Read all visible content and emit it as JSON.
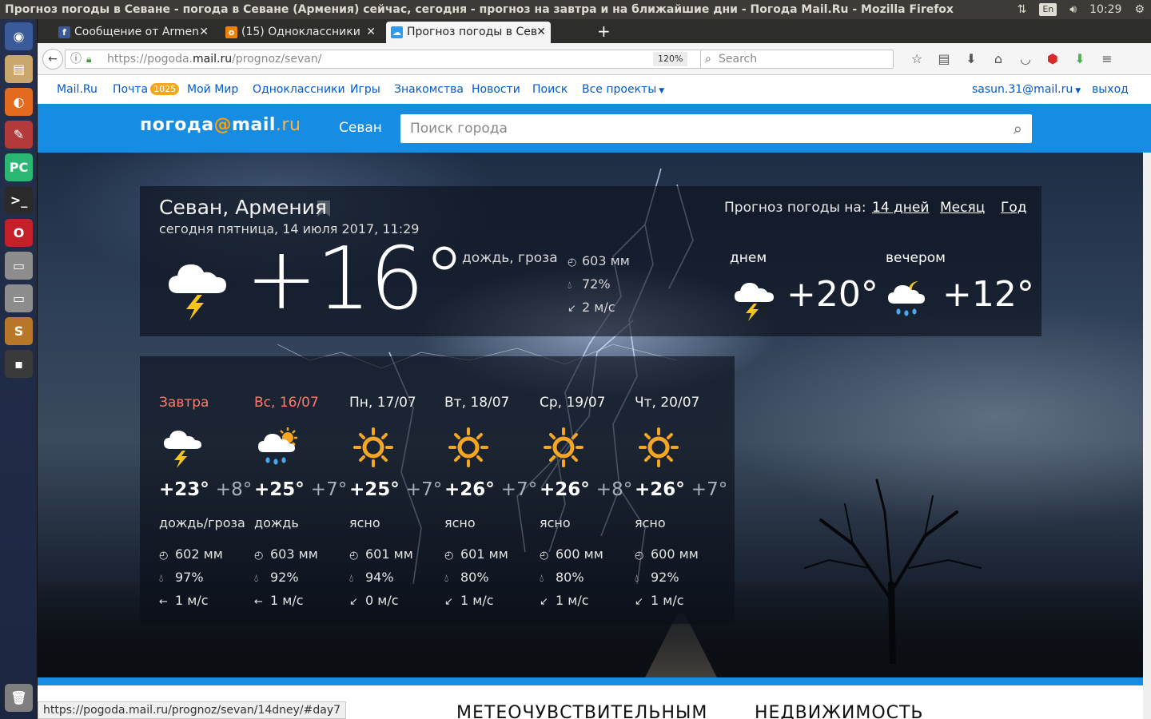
{
  "os": {
    "window_title": "Прогноз погоды в Севане - погода в Севане (Армения) сейчас, сегодня - прогноз на завтра и на ближайшие дни - Погода Mail.Ru - Mozilla Firefox",
    "lang": "En",
    "time": "10:29"
  },
  "tabs": [
    {
      "label": "Сообщение от Armen",
      "icon": "facebook-icon"
    },
    {
      "label": "(15) Одноклассники",
      "icon": "odnoklassniki-icon"
    },
    {
      "label": "Прогноз погоды в Сев",
      "icon": "weather-icon"
    }
  ],
  "nav": {
    "url_prefix": "https://pogoda.",
    "url_domain": "mail.ru",
    "url_path": "/prognoz/sevan/",
    "zoom": "120%",
    "search_placeholder": "Search"
  },
  "portal": {
    "mailru": "Mail.Ru",
    "pochta": "Почта",
    "pochta_count": "1025",
    "moi_mir": "Мой Мир",
    "ok": "Одноклассники",
    "games": "Игры",
    "dating": "Знакомства",
    "news": "Новости",
    "search": "Поиск",
    "all_projects": "Все проекты",
    "user": "sasun.31@mail.ru",
    "logout": "выход"
  },
  "brand": {
    "logo_a": "погода",
    "logo_at": "@",
    "logo_b": "mail",
    "logo_c": ".ru",
    "city_link": "Севан",
    "search_placeholder": "Поиск города"
  },
  "now": {
    "city": "Севан, Армения",
    "date": "сегодня пятница, 14 июля 2017, 11:29",
    "forecast_label": "Прогноз погоды на:",
    "links": [
      "14 дней",
      "Месяц",
      "Год"
    ],
    "temp": "+16°",
    "condition": "дождь, гроза",
    "pressure": "603 мм",
    "humidity": "72%",
    "wind": "2 м/с",
    "day_label": "днем",
    "day_temp": "+20°",
    "evening_label": "вечером",
    "evening_temp": "+12°"
  },
  "days": [
    {
      "name": "Завтра",
      "hi": "+23°",
      "lo": "+8°",
      "cond": "дождь/гроза",
      "pressure": "602 мм",
      "humidity": "97%",
      "wind_dir": "←",
      "wind": "1 м/с",
      "icon": "thunder-cloud-icon",
      "weekend": true
    },
    {
      "name": "Вс, 16/07",
      "hi": "+25°",
      "lo": "+7°",
      "cond": "дождь",
      "pressure": "603 мм",
      "humidity": "92%",
      "wind_dir": "←",
      "wind": "1 м/с",
      "icon": "sun-cloud-rain-icon",
      "weekend": true
    },
    {
      "name": "Пн, 17/07",
      "hi": "+25°",
      "lo": "+7°",
      "cond": "ясно",
      "pressure": "601 мм",
      "humidity": "94%",
      "wind_dir": "↙",
      "wind": "0 м/с",
      "icon": "sun-icon",
      "weekend": false
    },
    {
      "name": "Вт, 18/07",
      "hi": "+26°",
      "lo": "+7°",
      "cond": "ясно",
      "pressure": "601 мм",
      "humidity": "80%",
      "wind_dir": "↙",
      "wind": "1 м/с",
      "icon": "sun-icon",
      "weekend": false
    },
    {
      "name": "Ср, 19/07",
      "hi": "+26°",
      "lo": "+8°",
      "cond": "ясно",
      "pressure": "600 мм",
      "humidity": "80%",
      "wind_dir": "↙",
      "wind": "1 м/с",
      "icon": "sun-icon",
      "weekend": false
    },
    {
      "name": "Чт, 20/07",
      "hi": "+26°",
      "lo": "+7°",
      "cond": "ясно",
      "pressure": "600 мм",
      "humidity": "92%",
      "wind_dir": "↙",
      "wind": "1 м/с",
      "icon": "sun-icon",
      "weekend": false
    }
  ],
  "status_url": "https://pogoda.mail.ru/prognoz/sevan/14dney/#day7",
  "bottom": {
    "head1": "МЕТЕОЧУВСТВИТЕЛЬНЫМ",
    "head2": "НЕДВИЖИМОСТЬ"
  },
  "colors": {
    "accent": "#168de2",
    "weekend": "#ff7a6a",
    "sun": "#f5a623"
  }
}
